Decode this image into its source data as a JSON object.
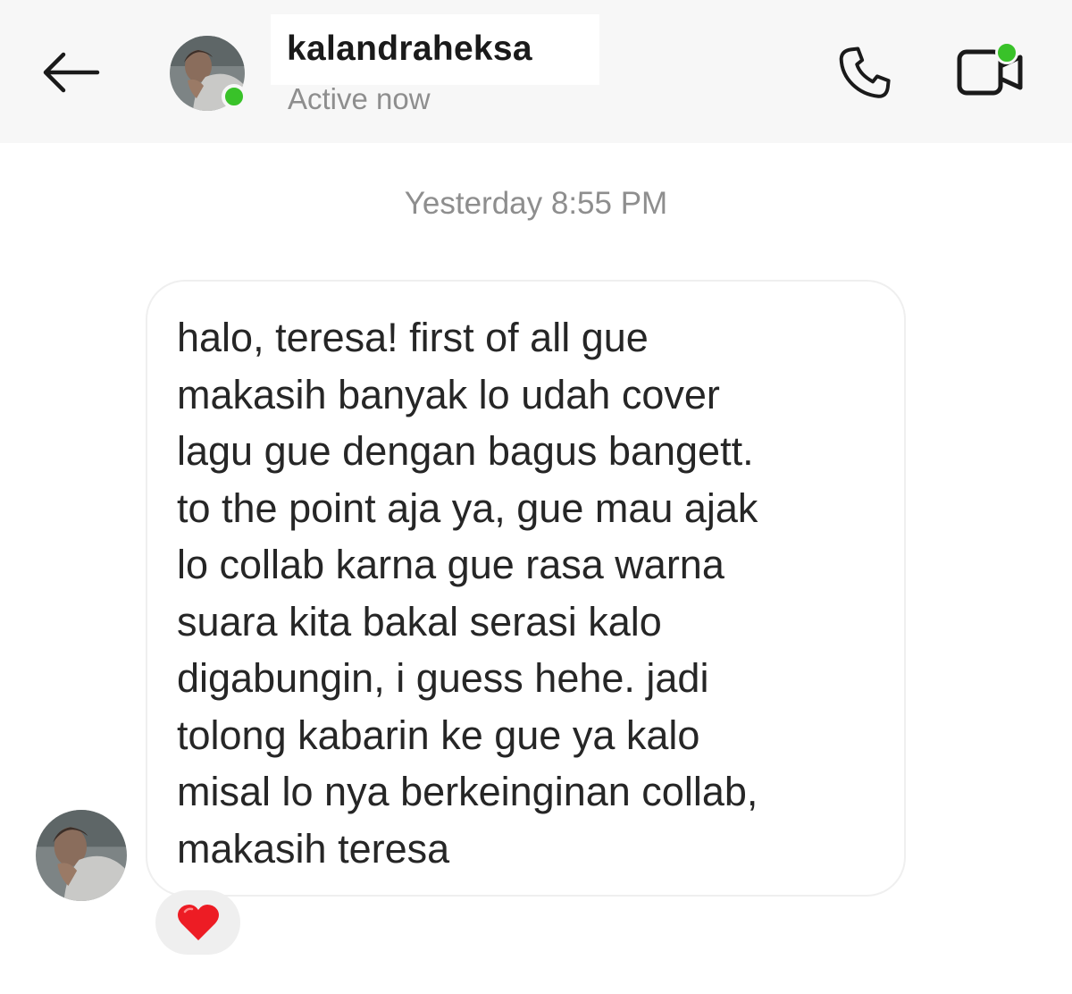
{
  "header": {
    "back_icon": "arrow-left-icon",
    "username": "kalandraheksa",
    "status": "Active now",
    "call_icon": "phone-icon",
    "video_icon": "video-camera-icon",
    "online_color": "#39c229"
  },
  "conversation": {
    "timestamp": "Yesterday 8:55 PM",
    "messages": [
      {
        "text": "halo, teresa! first of all gue\nmakasih banyak lo udah cover\nlagu gue dengan bagus bangett.\nto the point aja ya, gue mau ajak\nlo collab karna gue rasa warna\nsuara kita bakal serasi kalo\ndigabungin, i guess hehe. jadi\ntolong kabarin ke gue ya kalo\nmisal lo nya berkeinginan collab,\nmakasih teresa",
        "reaction_icon": "red-heart-icon"
      }
    ]
  }
}
